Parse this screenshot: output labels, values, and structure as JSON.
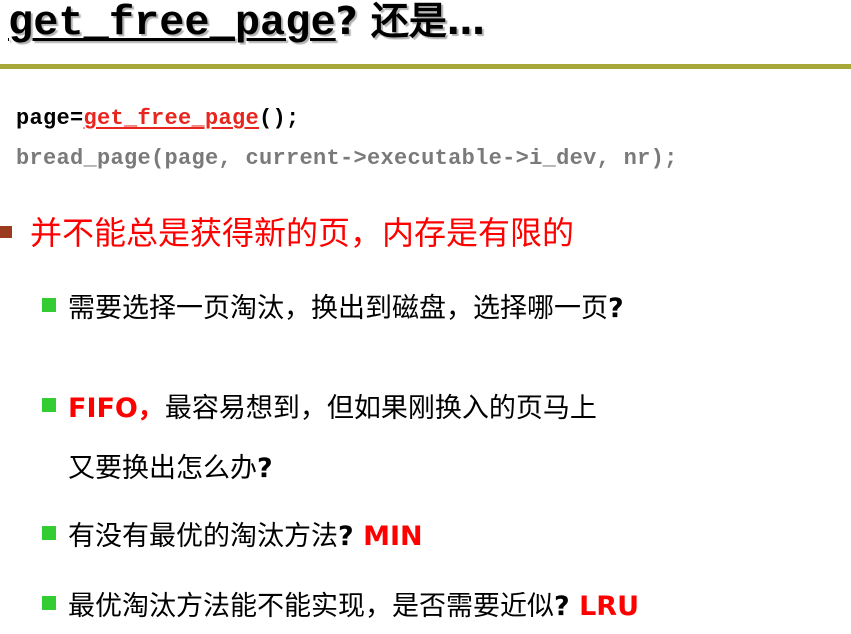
{
  "title": {
    "code": "get_free_page",
    "rest": "? 还是…"
  },
  "code": {
    "line1_prefix": "page=",
    "line1_fn": "get_free_page",
    "line1_suffix": "();",
    "line2": "bread_page(page, current->executable->i_dev, nr);"
  },
  "heading": "并不能总是获得新的页，内存是有限的",
  "items": [
    {
      "text": "需要选择一页淘汰，换出到磁盘，选择哪一页",
      "q": "?"
    },
    {
      "red": "FIFO，",
      "text": "最容易想到，但如果刚换入的页马上",
      "text2": "又要换出怎么办",
      "q": "?"
    },
    {
      "text": "有没有最优的淘汰方法",
      "q": "?",
      "red": " MIN"
    },
    {
      "text": "最优淘汰方法能不能实现，是否需要近似",
      "q": "?",
      "red": " LRU"
    }
  ],
  "colors": {
    "rule": "#a8a838",
    "red": "#ff0000",
    "bullet_l1": "#9a3b1e",
    "bullet_l2": "#33cc33",
    "code_gray": "#7a7a7a"
  }
}
